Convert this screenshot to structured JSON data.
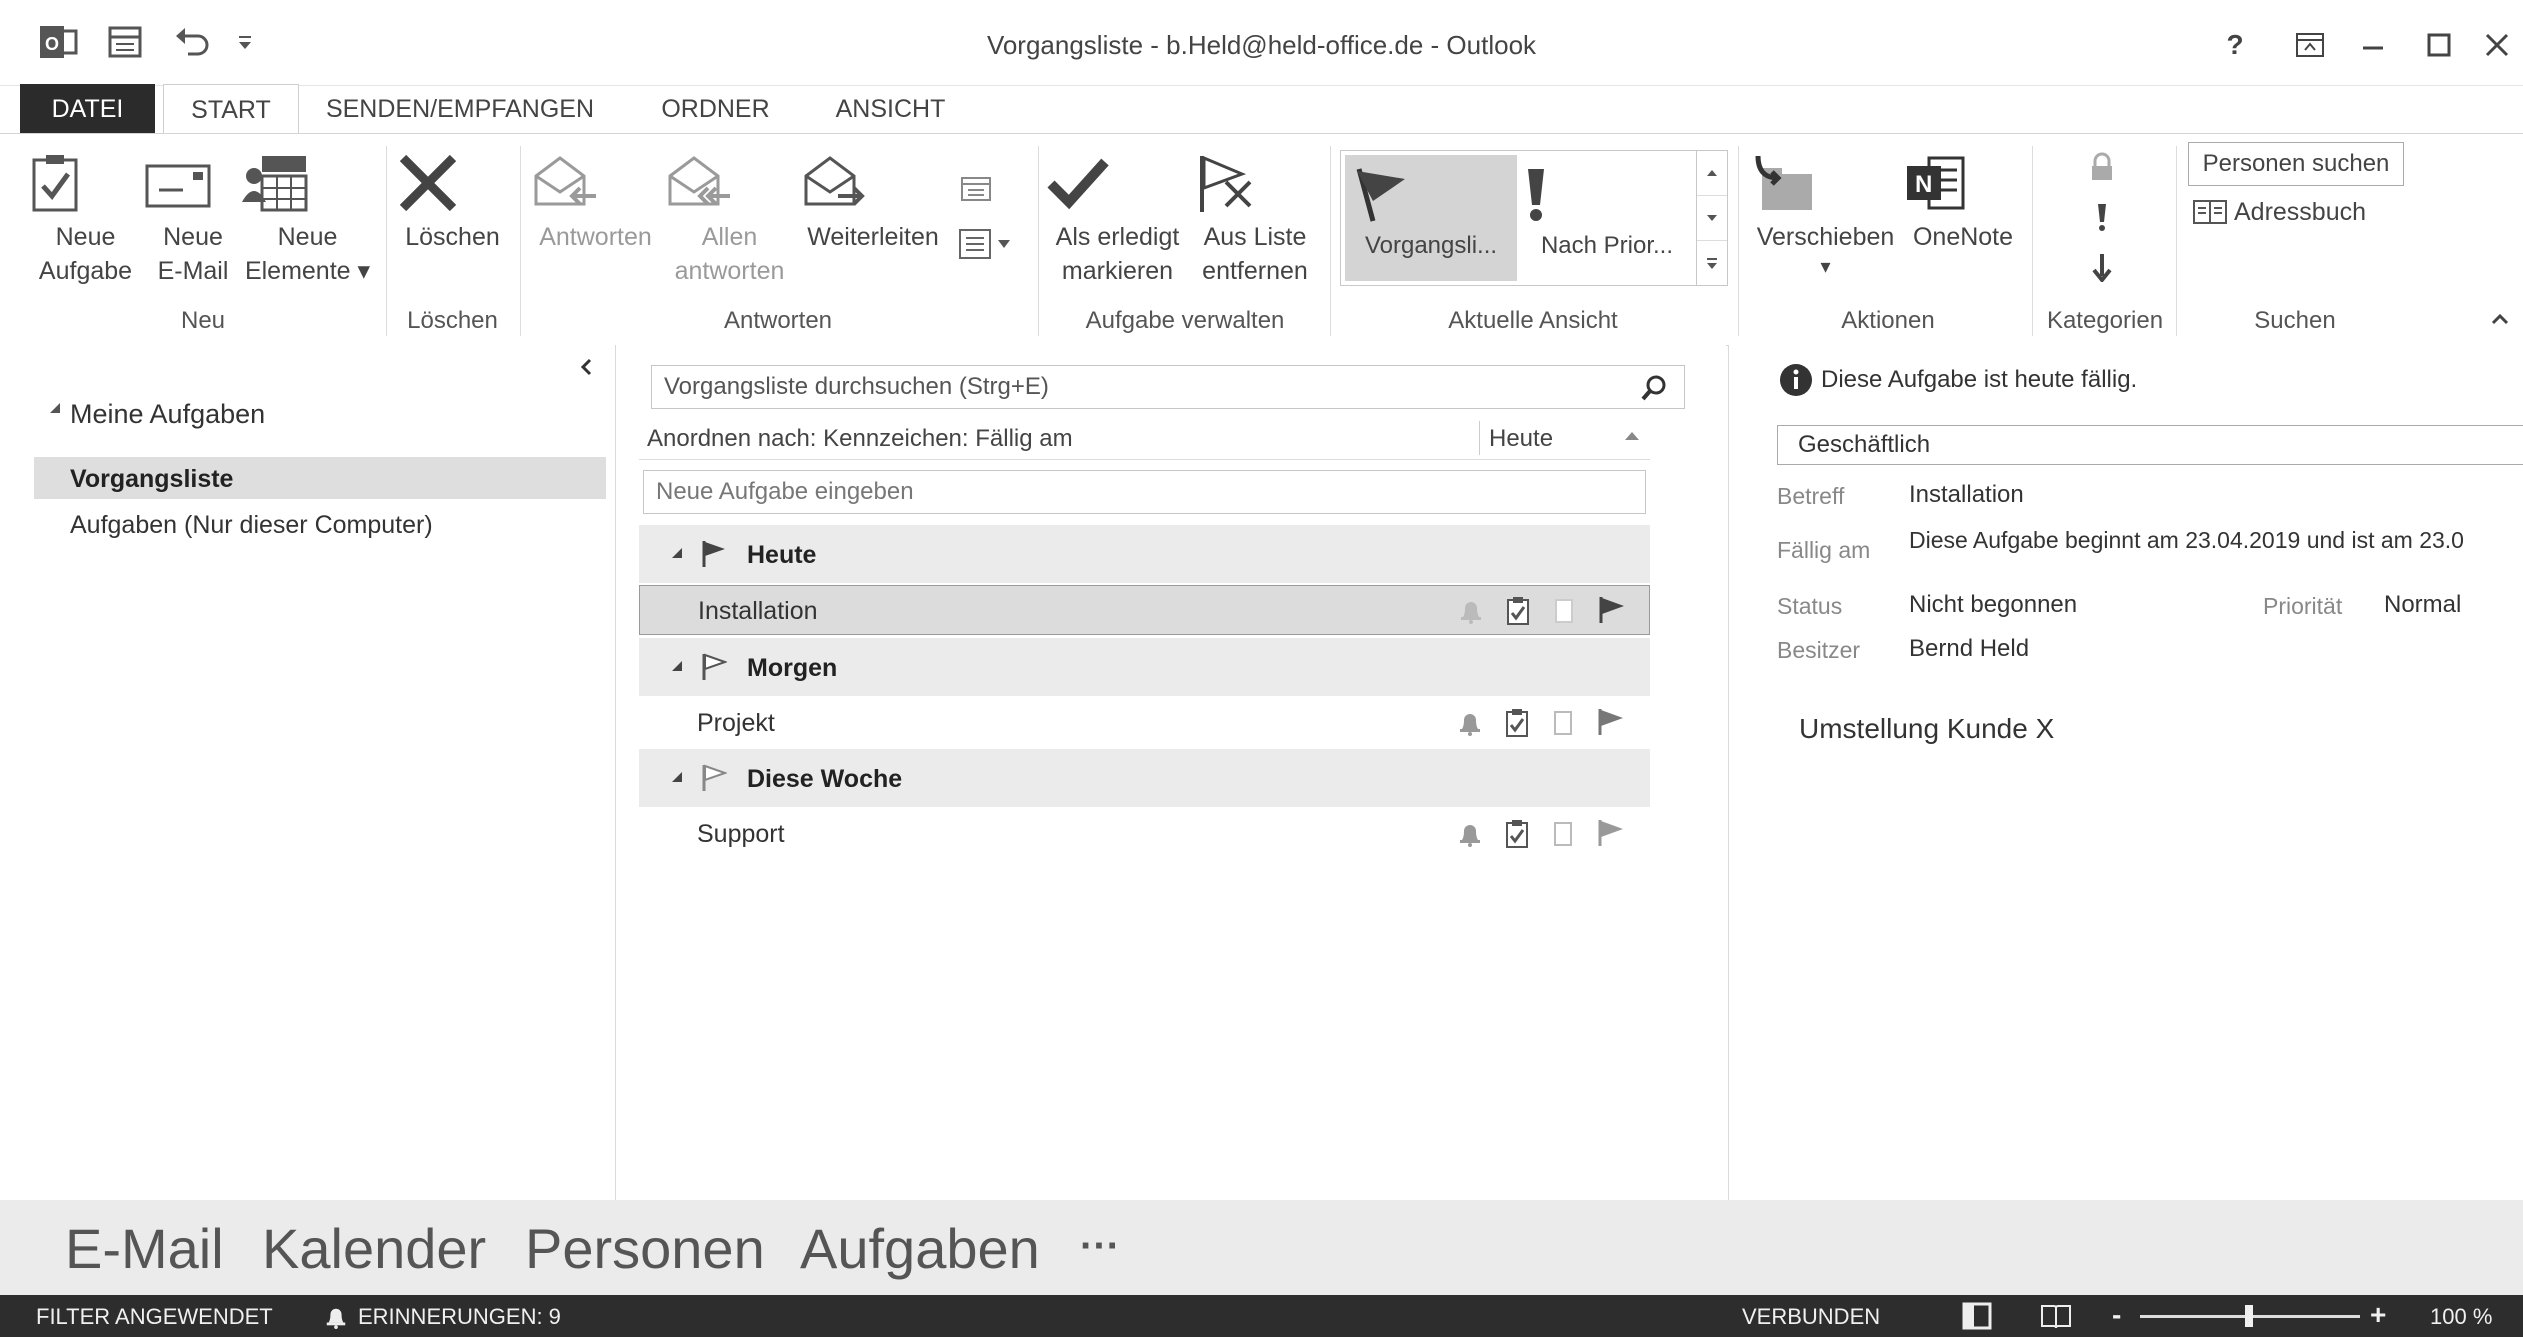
{
  "window": {
    "title": "Vorgangsliste - b.Held@held-office.de - Outlook",
    "help": "?",
    "controls": [
      "minimize",
      "maximize",
      "close"
    ]
  },
  "tabs": [
    {
      "label": "DATEI"
    },
    {
      "label": "START"
    },
    {
      "label": "SENDEN/EMPFANGEN"
    },
    {
      "label": "ORDNER"
    },
    {
      "label": "ANSICHT"
    }
  ],
  "ribbon": {
    "neu": {
      "group_label": "Neu",
      "new_task": [
        "Neue",
        "Aufgabe"
      ],
      "new_mail": [
        "Neue",
        "E-Mail"
      ],
      "new_items": [
        "Neue",
        "Elemente ▾"
      ]
    },
    "loeschen": {
      "group_label": "Löschen",
      "delete": "Löschen"
    },
    "antworten": {
      "group_label": "Antworten",
      "reply": "Antworten",
      "reply_all": [
        "Allen",
        "antworten"
      ],
      "forward": "Weiterleiten"
    },
    "verwalten": {
      "group_label": "Aufgabe verwalten",
      "mark_done": [
        "Als erledigt",
        "markieren"
      ],
      "remove_list": [
        "Aus Liste",
        "entfernen"
      ]
    },
    "ansicht": {
      "group_label": "Aktuelle Ansicht",
      "view_todo": "Vorgangsli...",
      "view_priority": "Nach Prior..."
    },
    "aktionen": {
      "group_label": "Aktionen",
      "move": "Verschieben",
      "move_arrow": "▾",
      "onenote": "OneNote"
    },
    "kategorien": {
      "group_label": "Kategorien"
    },
    "suchen": {
      "group_label": "Suchen",
      "people_search": "Personen suchen",
      "address_book": "Adressbuch"
    }
  },
  "nav": {
    "root": "Meine Aufgaben",
    "items": [
      {
        "label": "Vorgangsliste",
        "selected": true
      },
      {
        "label": "Aufgaben (Nur dieser Computer)",
        "selected": false
      }
    ]
  },
  "tasklist": {
    "search_placeholder": "Vorgangsliste durchsuchen (Strg+E)",
    "sort_label": "Anordnen nach: Kennzeichen: Fällig am",
    "sort_value": "Heute",
    "new_task_placeholder": "Neue Aufgabe eingeben",
    "groups": [
      {
        "label": "Heute",
        "task": "Installation",
        "selected": true
      },
      {
        "label": "Morgen",
        "task": "Projekt",
        "selected": false
      },
      {
        "label": "Diese Woche",
        "task": "Support",
        "selected": false
      }
    ]
  },
  "reading": {
    "info": "Diese Aufgabe ist heute fällig.",
    "category": "Geschäftlich",
    "fields": {
      "subject_label": "Betreff",
      "subject": "Installation",
      "due_label": "Fällig am",
      "due": "Diese Aufgabe beginnt am 23.04.2019 und ist am 23.0",
      "status_label": "Status",
      "status": "Nicht begonnen",
      "priority_label": "Priorität",
      "priority": "Normal",
      "owner_label": "Besitzer",
      "owner": "Bernd Held"
    },
    "body": "Umstellung Kunde X"
  },
  "modules": [
    "E-Mail",
    "Kalender",
    "Personen",
    "Aufgaben",
    "···"
  ],
  "status": {
    "filter": "FILTER ANGEWENDET",
    "reminders": "ERINNERUNGEN: 9",
    "connection": "VERBUNDEN",
    "zoom": "100 %",
    "zoom_minus": "-",
    "zoom_plus": "+"
  }
}
